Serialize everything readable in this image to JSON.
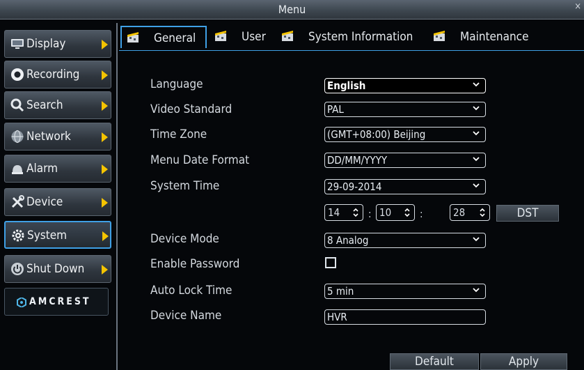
{
  "window": {
    "title": "Menu",
    "close_glyph": "×"
  },
  "sidebar": {
    "items": [
      {
        "label": "Display",
        "icon": "monitor-icon"
      },
      {
        "label": "Recording",
        "icon": "record-icon"
      },
      {
        "label": "Search",
        "icon": "search-icon"
      },
      {
        "label": "Network",
        "icon": "globe-icon"
      },
      {
        "label": "Alarm",
        "icon": "alarm-icon"
      },
      {
        "label": "Device",
        "icon": "tools-icon"
      },
      {
        "label": "System",
        "icon": "gear-icon",
        "active": true
      },
      {
        "label": "Shut Down",
        "icon": "power-icon"
      }
    ],
    "brand": "AMCREST"
  },
  "tabs": [
    {
      "label": "General",
      "active": true
    },
    {
      "label": "User"
    },
    {
      "label": "System Information"
    },
    {
      "label": "Maintenance"
    }
  ],
  "form": {
    "language": {
      "label": "Language",
      "value": "English"
    },
    "video_standard": {
      "label": "Video Standard",
      "value": "PAL"
    },
    "time_zone": {
      "label": "Time Zone",
      "value": "(GMT+08:00) Beijing"
    },
    "menu_date_format": {
      "label": "Menu Date Format",
      "value": "DD/MM/YYYY"
    },
    "system_time": {
      "label": "System Time",
      "date": "29-09-2014",
      "hour": "14",
      "minute": "10",
      "second": "28",
      "separator": ":",
      "dst_label": "DST"
    },
    "device_mode": {
      "label": "Device Mode",
      "value": "8 Analog"
    },
    "enable_password": {
      "label": "Enable Password",
      "checked": false
    },
    "auto_lock_time": {
      "label": "Auto Lock Time",
      "value": "5 min"
    },
    "device_name": {
      "label": "Device Name",
      "value": "HVR"
    }
  },
  "buttons": {
    "default": "Default",
    "apply": "Apply"
  },
  "colors": {
    "accent": "#3fa0e6",
    "arrow": "#f5c400"
  }
}
